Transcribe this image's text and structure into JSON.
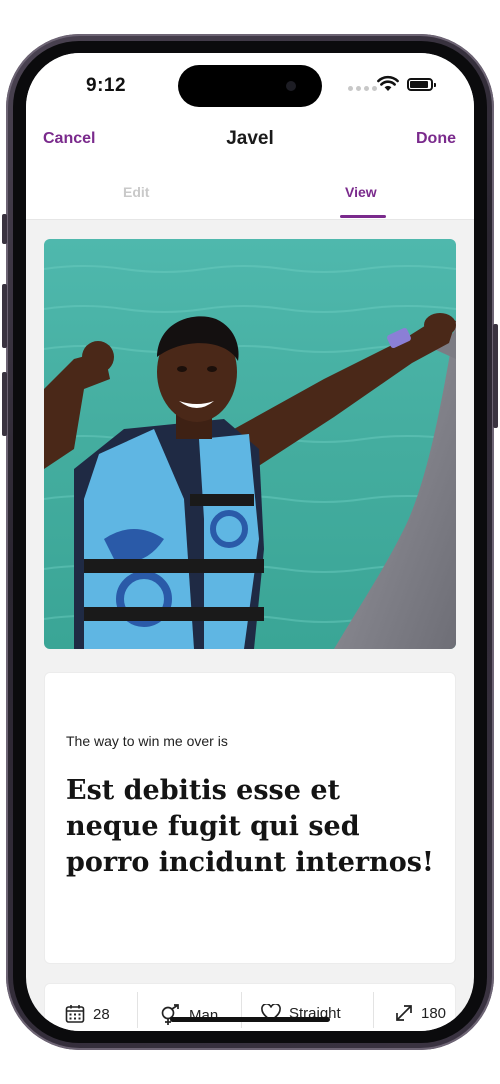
{
  "status_bar": {
    "time": "9:12"
  },
  "nav": {
    "cancel_label": "Cancel",
    "title": "Javel",
    "done_label": "Done"
  },
  "tabs": [
    {
      "label": "Edit",
      "active": false
    },
    {
      "label": "View",
      "active": true
    }
  ],
  "photo": {
    "subject": "man in blue life vest next to dolphin in turquoise water"
  },
  "prompt": {
    "label": "The way to win me over is",
    "answer": "Est debitis esse et neque fugit qui sed porro incidunt internos!"
  },
  "stats": [
    {
      "icon": "calendar-icon",
      "value": "28"
    },
    {
      "icon": "gender-icon",
      "value": "Man"
    },
    {
      "icon": "heart-icon",
      "value": "Straight"
    },
    {
      "icon": "height-arrow-icon",
      "value": "180"
    }
  ],
  "colors": {
    "accent": "#7a2a8c",
    "inactive_tab": "#c9c9c9",
    "background": "#f2f2f2"
  }
}
